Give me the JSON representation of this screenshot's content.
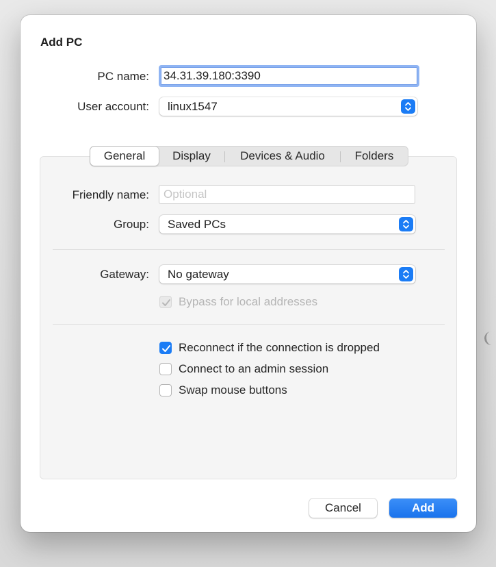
{
  "dialog": {
    "title": "Add PC",
    "pc_name": {
      "label": "PC name:",
      "value": "34.31.39.180:3390"
    },
    "user_account": {
      "label": "User account:",
      "value": "linux1547"
    },
    "tabs": [
      "General",
      "Display",
      "Devices & Audio",
      "Folders"
    ],
    "active_tab": "General",
    "general": {
      "friendly_name": {
        "label": "Friendly name:",
        "placeholder": "Optional",
        "value": ""
      },
      "group": {
        "label": "Group:",
        "value": "Saved PCs"
      },
      "gateway": {
        "label": "Gateway:",
        "value": "No gateway"
      },
      "bypass_local": {
        "label": "Bypass for local addresses",
        "checked": true,
        "enabled": false
      },
      "reconnect": {
        "label": "Reconnect if the connection is dropped",
        "checked": true
      },
      "admin_session": {
        "label": "Connect to an admin session",
        "checked": false
      },
      "swap_mouse": {
        "label": "Swap mouse buttons",
        "checked": false
      }
    },
    "buttons": {
      "cancel": "Cancel",
      "add": "Add"
    },
    "colors": {
      "accent": "#1b7cf5",
      "focus_ring": "#8fb4f3"
    },
    "icons": {
      "stepper": "up-down-chevron-icon",
      "checkmark": "checkmark-icon"
    }
  }
}
